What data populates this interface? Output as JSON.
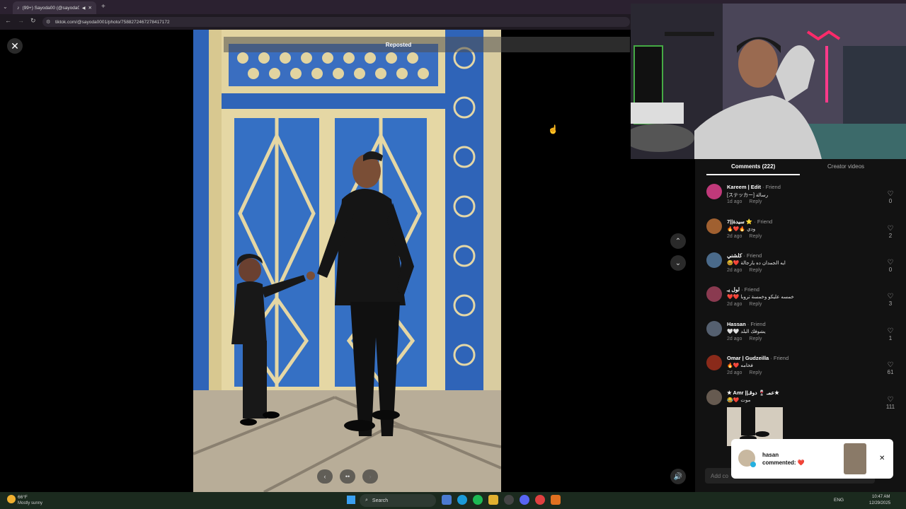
{
  "browser": {
    "tab_title": "(99+) Sayoda00 (@sayoda0...",
    "new_tab": "+",
    "url": "tiktok.com/@sayoda0001/photo/7588272467278417172"
  },
  "viewer": {
    "repost_label": "Reposted",
    "close_label": "✕",
    "prev_arrow": "‹",
    "next_arrow": "›",
    "up_arrow": "⌃",
    "down_arrow": "⌄",
    "sound_icon": "🔊",
    "dots": "••"
  },
  "panel": {
    "tab_comments": "Comments (222)",
    "tab_creator": "Creator videos",
    "add_comment_placeholder": "Add co",
    "comments": [
      {
        "name": "Kareem | Edit",
        "tag": " · Friend",
        "text": "[ステッカー] رسالة",
        "time": "1d ago",
        "reply": "Reply",
        "likes": "0",
        "avatar": "#c0397a"
      },
      {
        "name": "7||سيدة ⭐",
        "tag": " · Friend",
        "text": "🔥❤️🔥 ودي",
        "time": "2d ago",
        "reply": "Reply",
        "likes": "2",
        "avatar": "#a06030"
      },
      {
        "name": "كلشني",
        "tag": " · Friend",
        "text": "😆❤️ ايه الجمدان ده يارجالة",
        "time": "2d ago",
        "reply": "Reply",
        "likes": "0",
        "avatar": "#4a6a8a"
      },
      {
        "name": "لول يـ",
        "tag": " · Friend",
        "text": "❤️❤️ خمسه عليكو وخمسة تروبا",
        "time": "2d ago",
        "reply": "Reply",
        "likes": "3",
        "avatar": "#8a3a50"
      },
      {
        "name": "Hassan",
        "tag": " · Friend",
        "text": "🤍🤍 يشوفك البلد",
        "time": "2d ago",
        "reply": "Reply",
        "likes": "1",
        "avatar": "#556070"
      },
      {
        "name": "Omar | Gudzeilla",
        "tag": " · Friend",
        "text": "🔥❤️ فخامه",
        "time": "2d ago",
        "reply": "Reply",
        "likes": "61",
        "avatar": "#8a2a1a"
      },
      {
        "name": "★ Amr ||عمـ 🍷 دوقـ★",
        "tag": "",
        "text": "😂❤️ موت",
        "time": "",
        "reply": "",
        "likes": "111",
        "avatar": "#665a50"
      }
    ]
  },
  "notification": {
    "user": "hasan",
    "action": "commented: ❤️",
    "close": "✕"
  },
  "taskbar": {
    "temperature": "66°F",
    "weather": "Mostly sunny",
    "search_label": "Search",
    "lang": "ENG",
    "time": "10:47 AM",
    "date": "12/29/2025"
  }
}
